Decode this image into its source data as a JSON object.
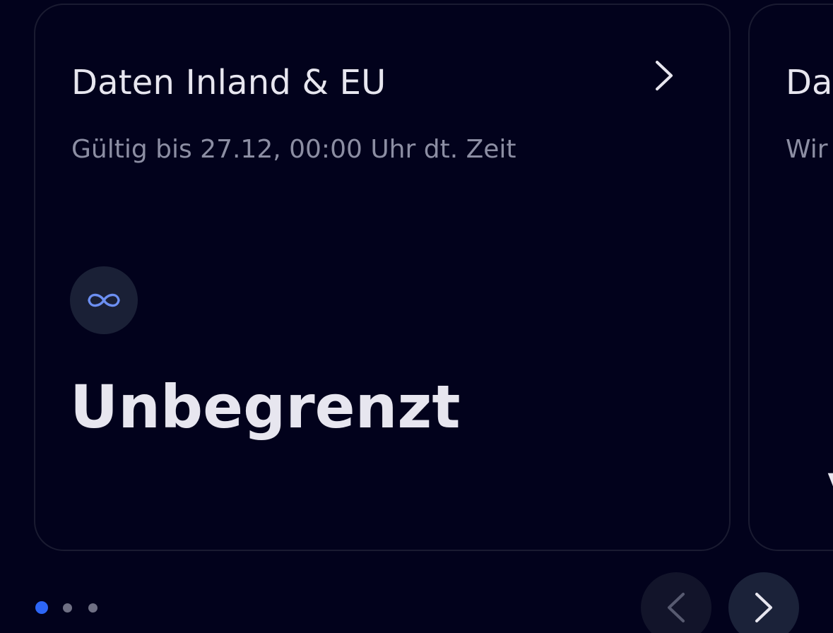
{
  "cards": [
    {
      "title": "Daten Inland & EU",
      "subtitle": "Gültig bis 27.12, 00:00 Uhr dt. Zeit",
      "badge_icon": "infinity-icon",
      "amount": "Unbegrenzt",
      "detail_icon": "chevron-right-icon"
    },
    {
      "title": "Da",
      "subtitle": "Wir",
      "mark": "v"
    }
  ],
  "pager": {
    "total": 3,
    "active_index": 0
  },
  "navigation": {
    "prev_icon": "chevron-left-icon",
    "next_icon": "chevron-right-icon"
  },
  "colors": {
    "background": "#02021c",
    "card_border": "#1a1b31",
    "text_primary": "#e7e6ef",
    "text_secondary": "#8c8ea3",
    "accent": "#2d66f6",
    "icon_accent": "#6c8ff2",
    "badge_bg": "#1a2036"
  }
}
